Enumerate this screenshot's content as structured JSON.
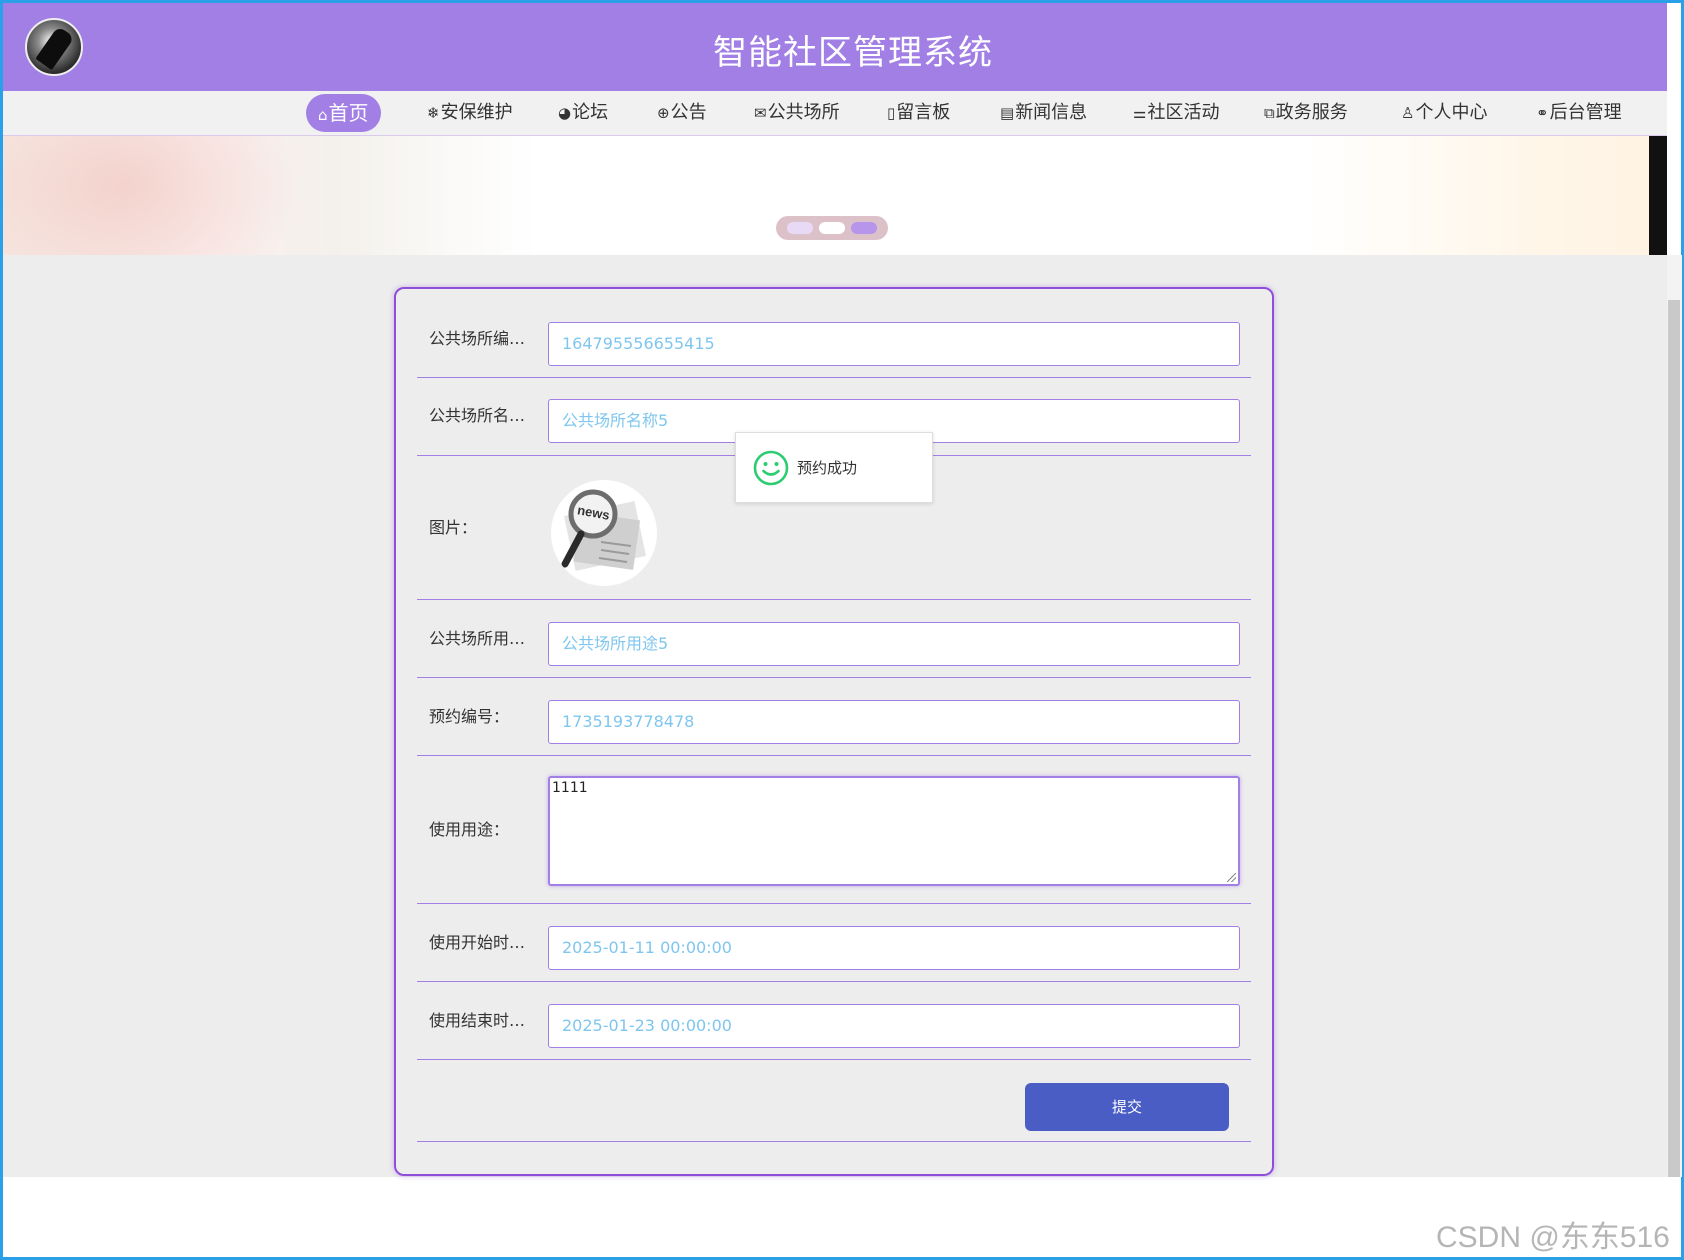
{
  "header": {
    "title": "智能社区管理系统"
  },
  "nav": {
    "items": [
      {
        "icon": "⌂",
        "label": "首页"
      },
      {
        "icon": "❄",
        "label": "安保维护"
      },
      {
        "icon": "◕",
        "label": "论坛"
      },
      {
        "icon": "⊕",
        "label": "公告"
      },
      {
        "icon": "✉",
        "label": "公共场所"
      },
      {
        "icon": "▯",
        "label": "留言板"
      },
      {
        "icon": "▤",
        "label": "新闻信息"
      },
      {
        "icon": "⚌",
        "label": "社区活动"
      },
      {
        "icon": "⧉",
        "label": "政务服务"
      },
      {
        "icon": "♙",
        "label": "个人中心"
      },
      {
        "icon": "⚭",
        "label": "后台管理"
      }
    ],
    "active": "首页"
  },
  "form": {
    "place_no": {
      "label": "公共场所编号：",
      "value": "164795556655415"
    },
    "place_name": {
      "label": "公共场所名称：",
      "value": "公共场所名称5"
    },
    "image": {
      "label": "图片：",
      "caption": "news"
    },
    "place_use": {
      "label": "公共场所用途：",
      "value": "公共场所用途5"
    },
    "booking_no": {
      "label": "预约编号：",
      "value": "1735193778478"
    },
    "usage": {
      "label": "使用用途：",
      "value": "1111"
    },
    "start_time": {
      "label": "使用开始时间：",
      "value": "2025-01-11 00:00:00"
    },
    "end_time": {
      "label": "使用结束时间：",
      "value": "2025-01-23 00:00:00"
    },
    "submit_label": "提交"
  },
  "toast": {
    "message": "预约成功",
    "icon": "smile-icon",
    "color": "#2ecc71"
  },
  "watermark": "CSDN @东东516",
  "colors": {
    "header": "#a27fe5",
    "submit": "#4a5dc4",
    "frame": "#2aa0e8"
  }
}
